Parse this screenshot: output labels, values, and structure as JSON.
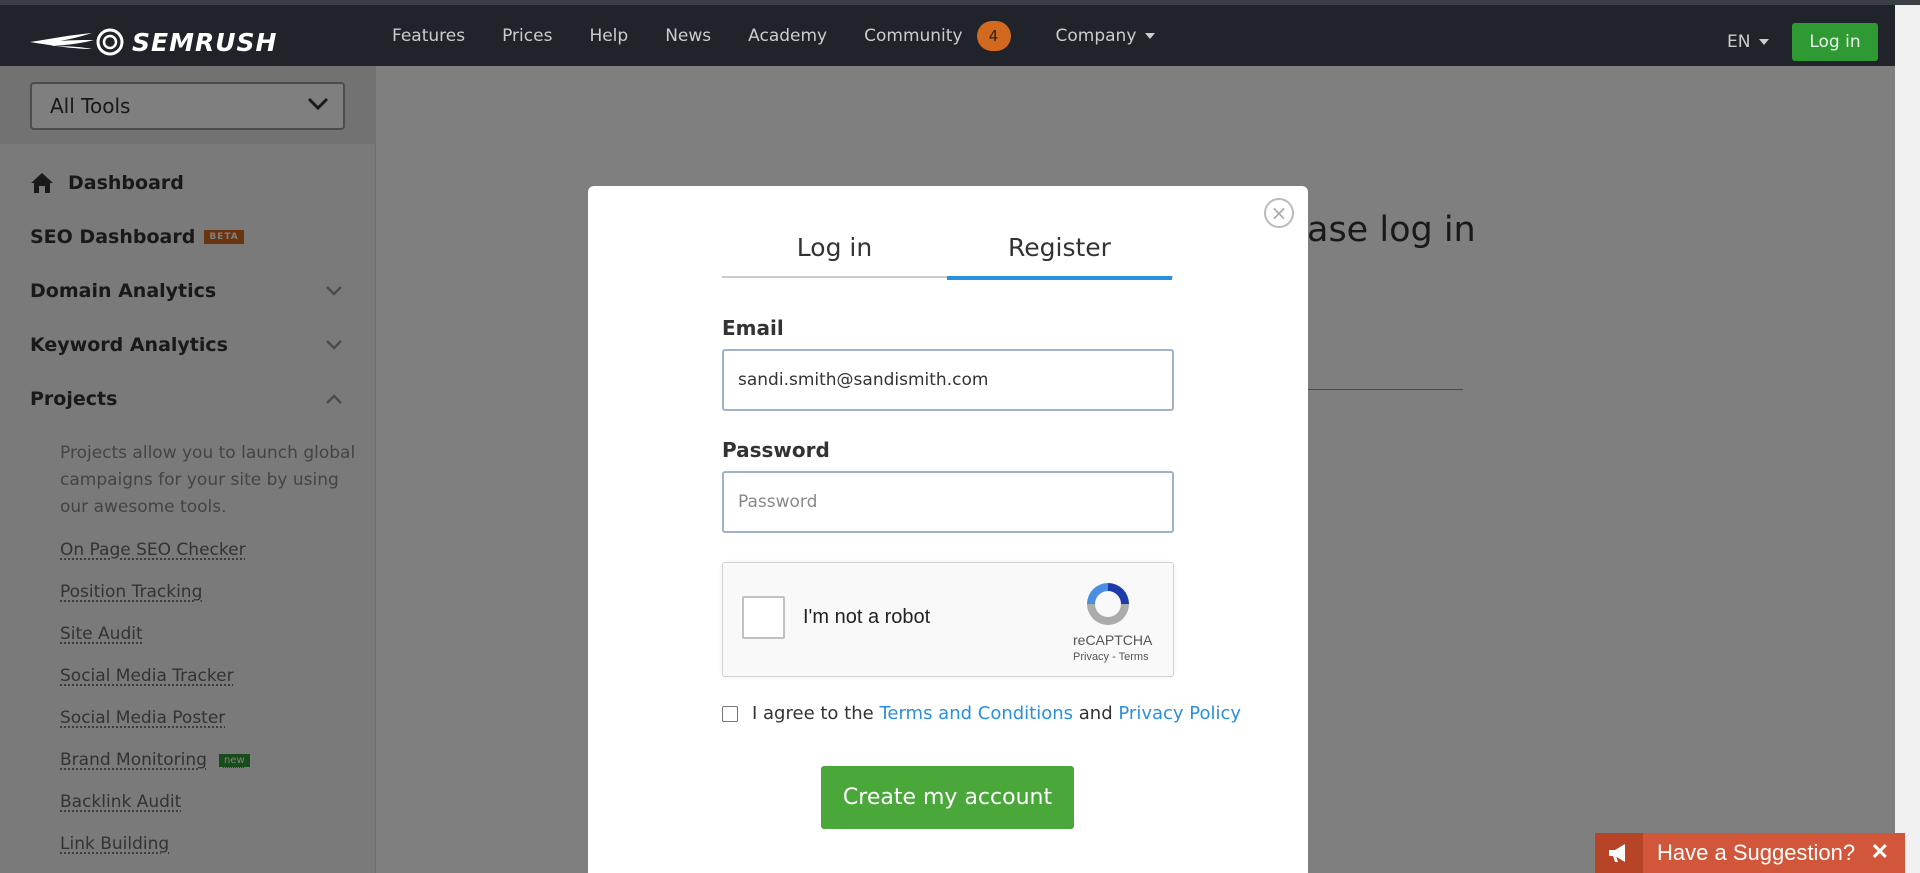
{
  "brand": {
    "name": "SEMRUSH"
  },
  "nav": {
    "items": [
      "Features",
      "Prices",
      "Help",
      "News",
      "Academy",
      "Community",
      "Company"
    ],
    "community_badge": "4",
    "language": "EN",
    "login_label": "Log in"
  },
  "sidebar": {
    "tools_select": "All Tools",
    "items": [
      "Dashboard",
      "SEO Dashboard",
      "Domain Analytics",
      "Keyword Analytics",
      "Projects"
    ],
    "beta_badge": "BETA",
    "projects_description": "Projects allow you to launch global campaigns for your site by using our awesome tools.",
    "project_tools": [
      "On Page SEO Checker",
      "Position Tracking",
      "Site Audit",
      "Social Media Tracker",
      "Social Media Poster",
      "Brand Monitoring",
      "Backlink Audit",
      "Link Building"
    ],
    "new_badge": "new"
  },
  "background": {
    "title_fragment": "ase log in"
  },
  "modal": {
    "tabs": [
      "Log in",
      "Register"
    ],
    "active_tab": "Register",
    "email_label": "Email",
    "email_value": "sandi.smith@sandismith.com",
    "password_label": "Password",
    "password_placeholder": "Password",
    "captcha": {
      "label": "I'm not a robot",
      "brand": "reCAPTCHA",
      "privacy": "Privacy",
      "terms": "Terms"
    },
    "agree": {
      "prefix": "I agree to the",
      "terms_link": "Terms and Conditions",
      "and": "and",
      "privacy_link": "Privacy Policy"
    },
    "create_button": "Create my account",
    "close_symbol": "×"
  },
  "suggestion": {
    "label": "Have a Suggestion?",
    "close": "✕"
  },
  "colors": {
    "accent_green": "#4aa83a",
    "link_blue": "#2a8fdc",
    "badge_orange": "#d2691e",
    "nav_bg": "#20242a"
  }
}
